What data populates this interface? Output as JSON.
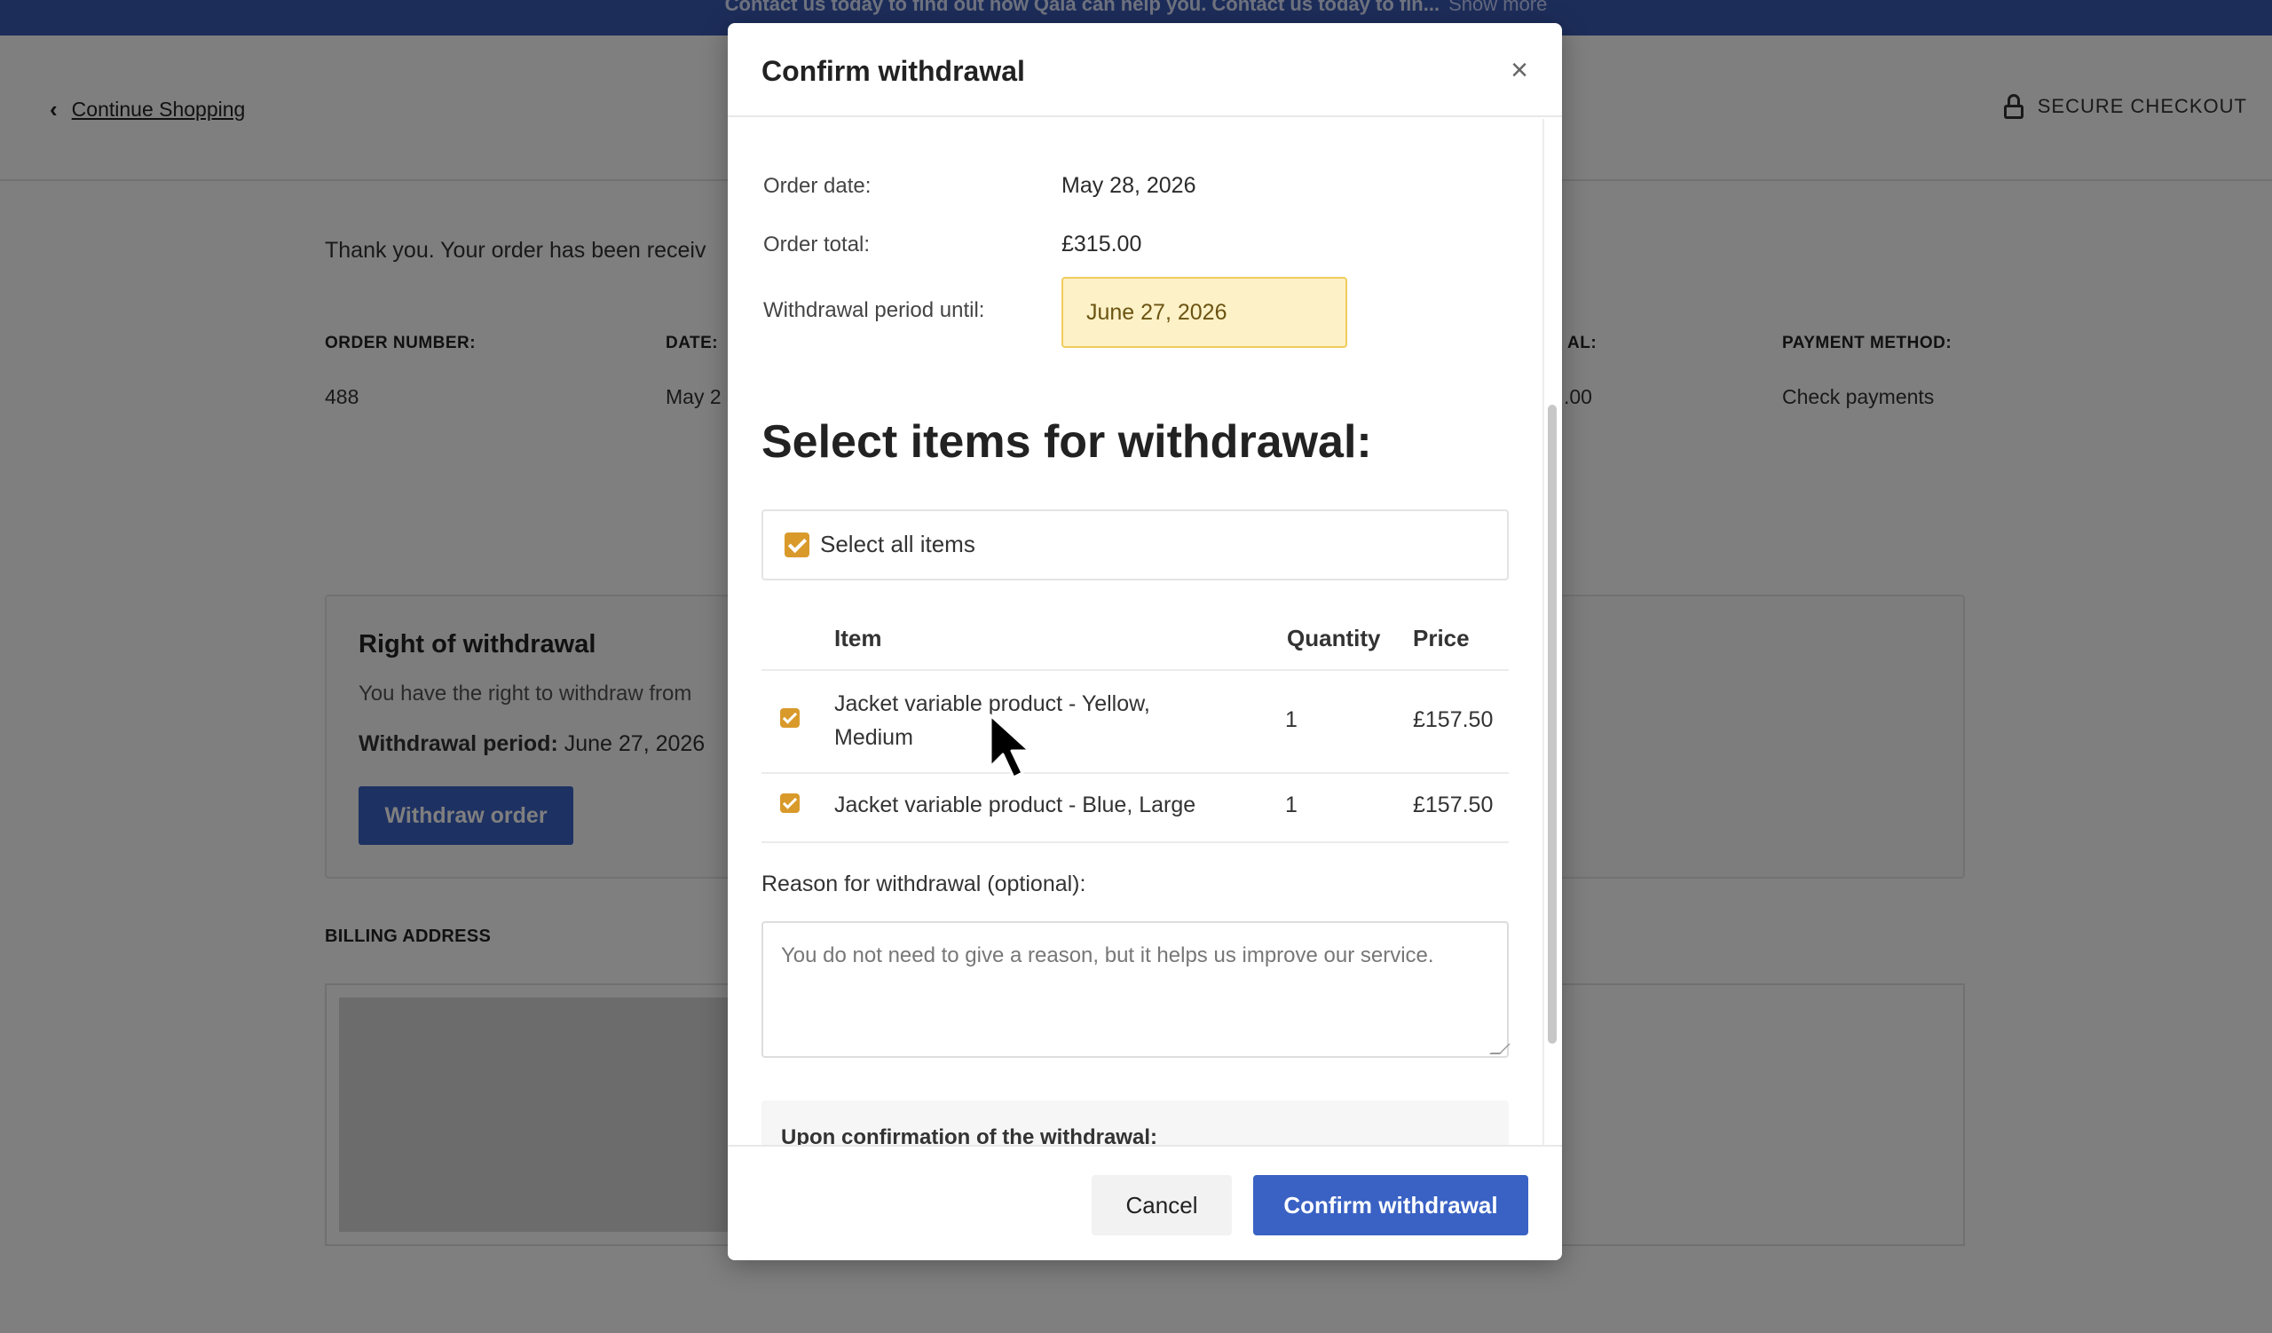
{
  "announcement": {
    "text": "Contact us today to find out how Qala can help you. Contact us today to fin...",
    "show_more": "Show more"
  },
  "header": {
    "continue_shopping": "Continue Shopping",
    "secure_checkout": "SECURE CHECKOUT"
  },
  "order_page": {
    "thank_you": "Thank you. Your order has been receiv",
    "labels": {
      "order_number": "ORDER NUMBER:",
      "date": "DATE:",
      "total_partial": "AL:",
      "payment_method": "PAYMENT METHOD:"
    },
    "values": {
      "order_number": "488",
      "date_partial": "May 2",
      "total_partial": ".00",
      "payment_method": "Check payments"
    },
    "right_of_withdrawal": {
      "title": "Right of withdrawal",
      "text": "You have the right to withdraw from",
      "period_label": "Withdrawal period:",
      "period_value": "June 27, 2026",
      "button": "Withdraw order"
    },
    "billing_address": "BILLING ADDRESS"
  },
  "modal": {
    "title": "Confirm withdrawal",
    "close_glyph": "×",
    "order_date_label": "Order date:",
    "order_date_value": "May 28, 2026",
    "order_total_label": "Order total:",
    "order_total_value": "£315.00",
    "withdrawal_period_label": "Withdrawal period until:",
    "withdrawal_period_value": "June 27, 2026",
    "select_heading": "Select items for withdrawal:",
    "select_all_label": "Select all items",
    "select_all_checked": true,
    "table": {
      "headers": {
        "item": "Item",
        "quantity": "Quantity",
        "price": "Price"
      },
      "rows": [
        {
          "item": "Jacket variable product - Yellow, Medium",
          "quantity": "1",
          "price": "£157.50",
          "checked": true
        },
        {
          "item": "Jacket variable product - Blue, Large",
          "quantity": "1",
          "price": "£157.50",
          "checked": true
        }
      ]
    },
    "reason_label": "Reason for withdrawal (optional):",
    "reason_placeholder": "You do not need to give a reason, but it helps us improve our service.",
    "upon_confirmation": "Upon confirmation of the withdrawal:",
    "cancel_button": "Cancel",
    "confirm_button": "Confirm withdrawal"
  },
  "colors": {
    "primary_blue": "#3a62c4",
    "checkbox_orange": "#d99a2b",
    "highlight_yellow": "#fdf1c7"
  }
}
